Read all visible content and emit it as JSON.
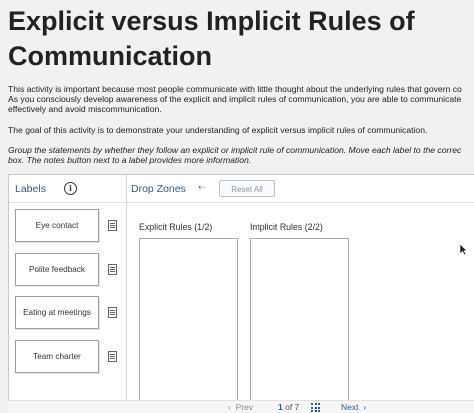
{
  "title_lines": [
    "Explicit versus Implicit Rules of",
    "Communication"
  ],
  "intro_lines": [
    "This activity is important because most people communicate with little thought about the underlying rules that govern co",
    "As you consciously develop awareness of the explicit and implicit rules of communication, you are able to communicate",
    "effectively and avoid miscommunication."
  ],
  "goal_text": "The goal of this activity is to demonstrate your understanding of explicit versus implicit rules of communication.",
  "instruction_lines": [
    "Group the statements by whether they follow an explicit or implicit rule of communication. Move each label to the correc",
    "box. The notes button next to a label provides more information."
  ],
  "labels_panel": {
    "header": "Labels",
    "info_icon": "info-icon",
    "items": [
      {
        "text": "Eye contact",
        "icon": "notes-icon"
      },
      {
        "text": "Polite feedback",
        "icon": "notes-icon"
      },
      {
        "text": "Eating at meetings",
        "icon": "notes-icon"
      },
      {
        "text": "Team charter",
        "icon": "notes-icon"
      }
    ]
  },
  "drop_panel": {
    "header": "Drop Zones",
    "arrow_icon": "arrow-left-icon",
    "reset_label": "Reset All",
    "zones": [
      {
        "title": "Explicit Rules (1/2)"
      },
      {
        "title": "Implicit Rules (2/2)"
      }
    ]
  },
  "pagination": {
    "prev_label": "Prev",
    "current": "1",
    "of_label": "of",
    "total": "7",
    "grid_icon": "grid-icon",
    "next_label": "Next"
  },
  "colors": {
    "accent": "#2f5c8c",
    "background": "#f1f1f1",
    "panel": "#ffffff"
  }
}
